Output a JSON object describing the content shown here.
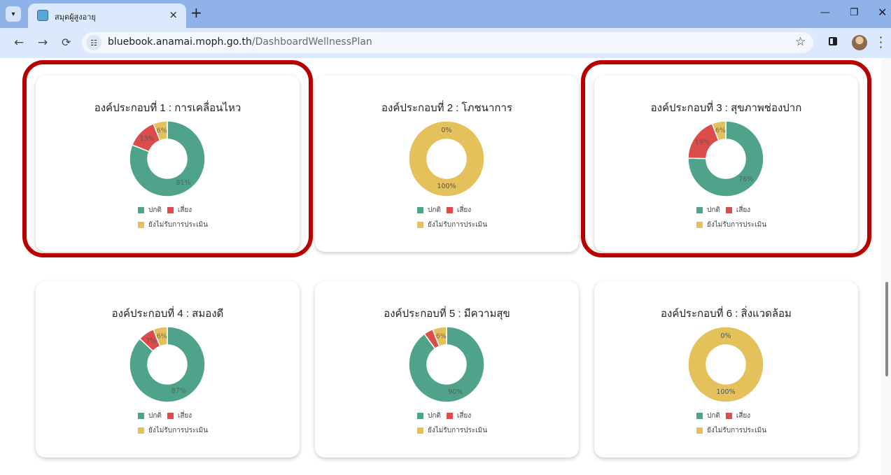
{
  "browser": {
    "tab_title": "สมุดผู้สูงอายุ",
    "tab_close": "×",
    "new_tab": "+",
    "url_host": "bluebook.anamai.moph.go.th",
    "url_path": "/DashboardWellnessPlan"
  },
  "legend": {
    "normal": "ปกติ",
    "risk": "เสี่ยง",
    "not_assessed": "ยังไม่รับการประเมิน"
  },
  "colors": {
    "normal": "#4fa38a",
    "risk": "#dc4c4c",
    "not_assessed": "#e5c15b",
    "highlight": "#b80000"
  },
  "cards": [
    {
      "title": "องค์ประกอบที่ 1 : การเคลื่อนไหว",
      "highlighted": true
    },
    {
      "title": "องค์ประกอบที่ 2 : โภชนาการ",
      "highlighted": false
    },
    {
      "title": "องค์ประกอบที่ 3 : สุขภาพช่องปาก",
      "highlighted": true
    },
    {
      "title": "องค์ประกอบที่ 4 : สมองดี",
      "highlighted": false
    },
    {
      "title": "องค์ประกอบที่ 5 : มีความสุข",
      "highlighted": false
    },
    {
      "title": "องค์ประกอบที่ 6 : สิ่งแวดล้อม",
      "highlighted": false
    }
  ],
  "chart_data": [
    {
      "type": "pie",
      "title": "องค์ประกอบที่ 1 : การเคลื่อนไหว",
      "categories": [
        "ปกติ",
        "เสี่ยง",
        "ยังไม่รับการประเมิน"
      ],
      "values": [
        81,
        13,
        6
      ],
      "labels": [
        "81%",
        "13%",
        "6%"
      ]
    },
    {
      "type": "pie",
      "title": "องค์ประกอบที่ 2 : โภชนาการ",
      "categories": [
        "ปกติ",
        "เสี่ยง",
        "ยังไม่รับการประเมิน"
      ],
      "values": [
        0,
        0,
        100
      ],
      "labels": [
        "0%",
        "",
        "100%"
      ]
    },
    {
      "type": "pie",
      "title": "องค์ประกอบที่ 3 : สุขภาพช่องปาก",
      "categories": [
        "ปกติ",
        "เสี่ยง",
        "ยังไม่รับการประเมิน"
      ],
      "values": [
        76,
        19,
        6
      ],
      "labels": [
        "76%",
        "19%",
        "6%"
      ]
    },
    {
      "type": "pie",
      "title": "องค์ประกอบที่ 4 : สมองดี",
      "categories": [
        "ปกติ",
        "เสี่ยง",
        "ยังไม่รับการประเมิน"
      ],
      "values": [
        87,
        7,
        6
      ],
      "labels": [
        "87%",
        "7%",
        "6%"
      ]
    },
    {
      "type": "pie",
      "title": "องค์ประกอบที่ 5 : มีความสุข",
      "categories": [
        "ปกติ",
        "เสี่ยง",
        "ยังไม่รับการประเมิน"
      ],
      "values": [
        90,
        4,
        6
      ],
      "labels": [
        "90%",
        "",
        "6%"
      ]
    },
    {
      "type": "pie",
      "title": "องค์ประกอบที่ 6 : สิ่งแวดล้อม",
      "categories": [
        "ปกติ",
        "เสี่ยง",
        "ยังไม่รับการประเมิน"
      ],
      "values": [
        0,
        0,
        100
      ],
      "labels": [
        "0%",
        "",
        "100%"
      ]
    }
  ]
}
